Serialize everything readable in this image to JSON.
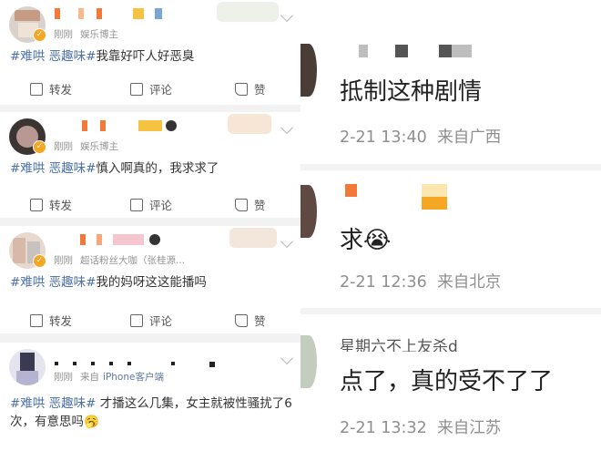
{
  "posts": [
    {
      "time": "刚刚",
      "source": "娱乐博主",
      "tags": "#难哄 恶趣味#",
      "text": "我靠好吓人好恶臭",
      "repost_label": "转发",
      "comment_label": "评论",
      "like_label": "赞"
    },
    {
      "time": "刚刚",
      "source": "娱乐博主",
      "tags": "#难哄 恶趣味#",
      "text": "慎入啊真的，我求求了",
      "repost_label": "转发",
      "comment_label": "评论",
      "like_label": "赞"
    },
    {
      "time": "刚刚",
      "source": "超话粉丝大咖（张桂源...",
      "tags": "#难哄 恶趣味#",
      "text": "我的妈呀这这能播吗",
      "repost_label": "转发",
      "comment_label": "评论",
      "like_label": "赞"
    },
    {
      "time": "刚刚",
      "source_prefix": "来自",
      "source": "iPhone客户端",
      "tags": "#难哄 恶趣味#",
      "text": " 才播这么几集，女主就被性骚扰了6次，有意思吗🥱"
    }
  ],
  "comments": [
    {
      "text": "抵制这种剧情",
      "time": "2-21 13:40",
      "location": "来自广西"
    },
    {
      "text": "求😭",
      "time": "2-21 12:36",
      "location": "来自北京"
    },
    {
      "name": "星期六不上友杀d",
      "text": "点了，真的受不了了",
      "time": "2-21 13:32",
      "location": "来自江苏"
    }
  ],
  "colors": {
    "tag": "#4a6ea8",
    "badge": "#f5a623",
    "meta": "#939393"
  }
}
